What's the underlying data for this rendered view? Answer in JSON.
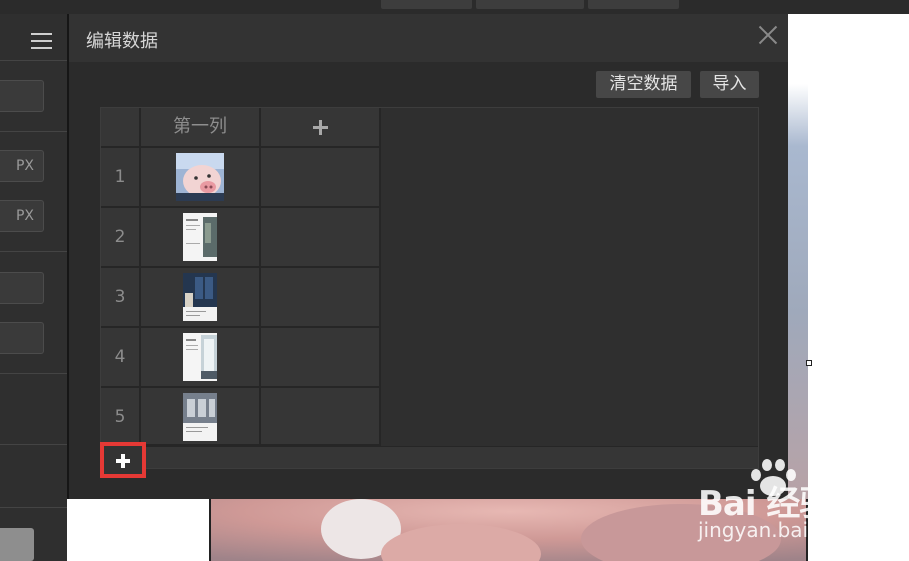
{
  "dialog": {
    "title": "编辑数据",
    "toolbar": {
      "clear_label": "清空数据",
      "import_label": "导入"
    }
  },
  "grid": {
    "column_header": "第一列",
    "rows": [
      "1",
      "2",
      "3",
      "4",
      "5"
    ]
  },
  "left_panel": {
    "unit_label_1": "PX",
    "unit_label_2": "PX"
  },
  "watermark": {
    "main": "Bai 经验",
    "sub": "jingyan.baidu.com"
  }
}
